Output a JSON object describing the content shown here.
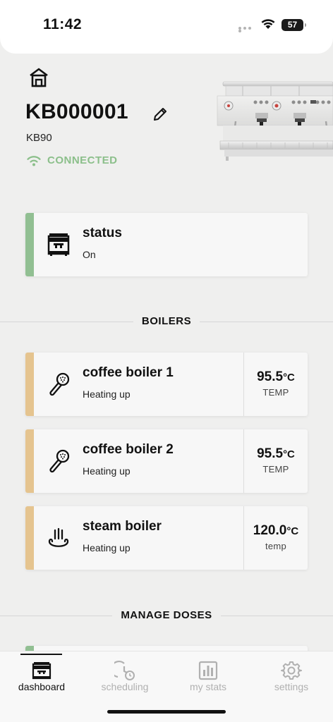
{
  "status_bar": {
    "time": "11:42",
    "battery": "57"
  },
  "header": {
    "machine_name": "KB000001",
    "model": "KB90",
    "connection": "CONNECTED"
  },
  "status_card": {
    "title": "status",
    "value": "On",
    "accent": "#91bf92"
  },
  "boilers_section": {
    "title": "BOILERS"
  },
  "boilers": [
    {
      "title": "coffee boiler 1",
      "state": "Heating up",
      "temp": "95.5",
      "unit": "°C",
      "label": "TEMP"
    },
    {
      "title": "coffee boiler 2",
      "state": "Heating up",
      "temp": "95.5",
      "unit": "°C",
      "label": "TEMP"
    },
    {
      "title": "steam boiler",
      "state": "Heating up",
      "temp": "120.0",
      "unit": "°C",
      "label": "temp"
    }
  ],
  "boiler_accent": "#e5c48f",
  "doses_section": {
    "title": "MANAGE DOSES"
  },
  "tabs": [
    {
      "label": "dashboard",
      "icon": "espresso-machine-icon",
      "active": true
    },
    {
      "label": "scheduling",
      "icon": "schedule-clock-icon",
      "active": false
    },
    {
      "label": "my stats",
      "icon": "bar-chart-icon",
      "active": false
    },
    {
      "label": "settings",
      "icon": "gear-icon",
      "active": false
    }
  ]
}
